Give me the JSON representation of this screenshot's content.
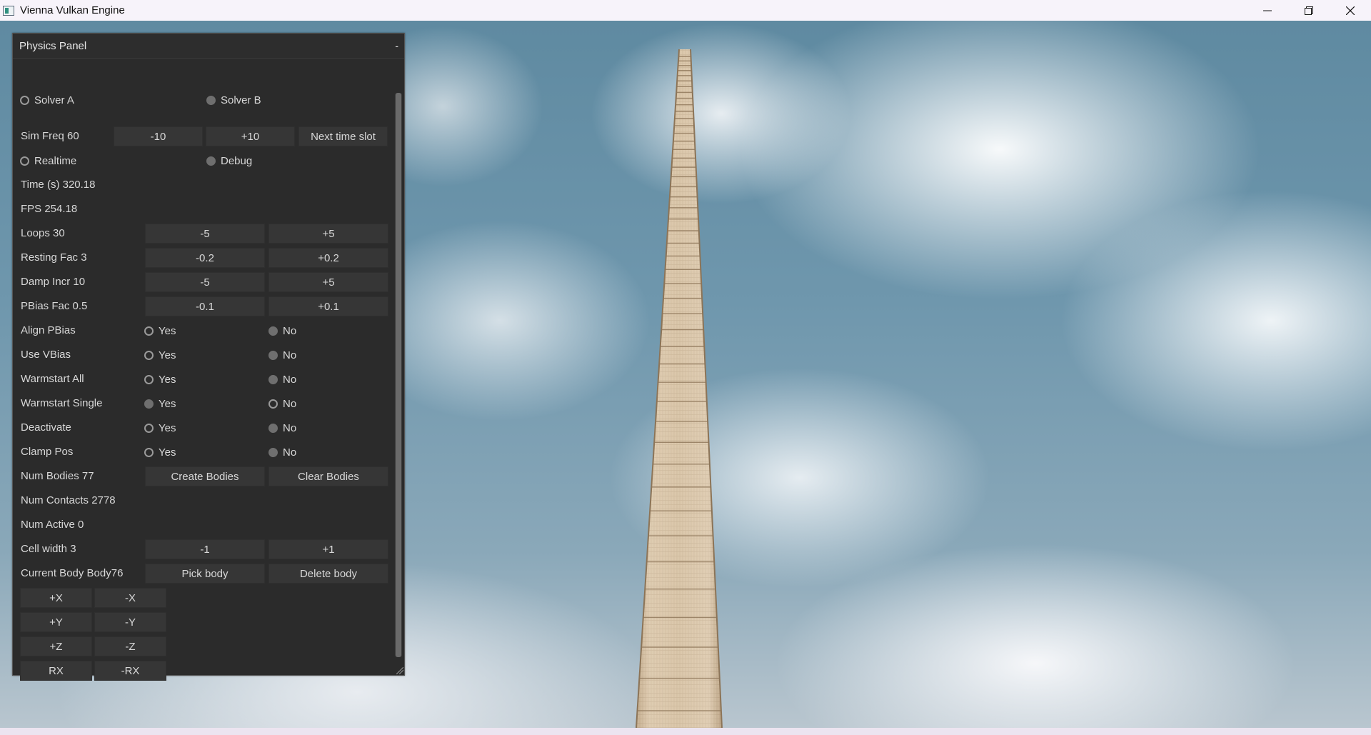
{
  "window": {
    "title": "Vienna Vulkan Engine",
    "minimize_icon": "minimize-icon",
    "restore_icon": "restore-icon",
    "close_icon": "close-icon"
  },
  "panel": {
    "title": "Physics Panel",
    "collapse_label": "-",
    "solver": {
      "a": "Solver A",
      "b": "Solver B",
      "selected": "b"
    },
    "sim_freq": {
      "label": "Sim Freq 60",
      "dec": "-10",
      "inc": "+10",
      "next": "Next time slot"
    },
    "mode": {
      "realtime": "Realtime",
      "debug": "Debug",
      "selected": "debug"
    },
    "time": "Time (s)  320.18",
    "fps": "FPS 254.18",
    "params": [
      {
        "label": "Loops 30",
        "dec": "-5",
        "inc": "+5"
      },
      {
        "label": "Resting Fac 3",
        "dec": "-0.2",
        "inc": "+0.2"
      },
      {
        "label": "Damp Incr 10",
        "dec": "-5",
        "inc": "+5"
      },
      {
        "label": "PBias Fac 0.5",
        "dec": "-0.1",
        "inc": "+0.1"
      }
    ],
    "toggles": [
      {
        "label": "Align PBias",
        "yes": "Yes",
        "no": "No",
        "selected": "no"
      },
      {
        "label": "Use VBias",
        "yes": "Yes",
        "no": "No",
        "selected": "no"
      },
      {
        "label": "Warmstart All",
        "yes": "Yes",
        "no": "No",
        "selected": "no"
      },
      {
        "label": "Warmstart Single",
        "yes": "Yes",
        "no": "No",
        "selected": "yes"
      },
      {
        "label": "Deactivate",
        "yes": "Yes",
        "no": "No",
        "selected": "no"
      },
      {
        "label": "Clamp Pos",
        "yes": "Yes",
        "no": "No",
        "selected": "no"
      }
    ],
    "bodies": {
      "label": "Num Bodies 77",
      "create": "Create Bodies",
      "clear": "Clear Bodies"
    },
    "contacts": "Num Contacts 2778",
    "active": "Num Active 0",
    "cell": {
      "label": "Cell width 3",
      "dec": "-1",
      "inc": "+1"
    },
    "current": {
      "label": "Current Body Body76",
      "pick": "Pick body",
      "delete": "Delete body"
    },
    "move": [
      {
        "pos": "+X",
        "neg": "-X"
      },
      {
        "pos": "+Y",
        "neg": "-Y"
      },
      {
        "pos": "+Z",
        "neg": "-Z"
      },
      {
        "pos": "RX",
        "neg": "-RX"
      }
    ]
  }
}
